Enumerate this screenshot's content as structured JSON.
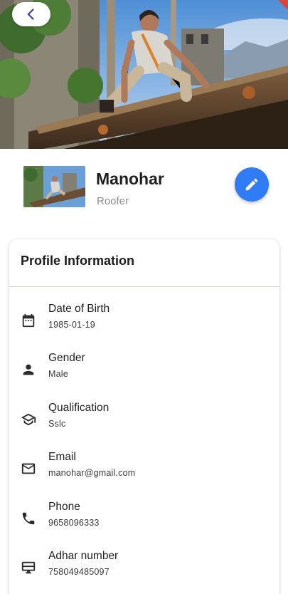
{
  "header": {
    "back_icon": "chevron-left-icon",
    "edit_icon": "pencil-icon",
    "accent": "#2f7cf6"
  },
  "profile": {
    "name": "Manohar",
    "role": "Roofer"
  },
  "card": {
    "title": "Profile Information",
    "items": [
      {
        "icon": "calendar-icon",
        "label": "Date of Birth",
        "value": "1985-01-19"
      },
      {
        "icon": "person-icon",
        "label": "Gender",
        "value": "Male"
      },
      {
        "icon": "graduation-cap-icon",
        "label": "Qualification",
        "value": "Sslc"
      },
      {
        "icon": "mail-icon",
        "label": "Email",
        "value": "manohar@gmail.com"
      },
      {
        "icon": "phone-icon",
        "label": "Phone",
        "value": "9658096333"
      },
      {
        "icon": "id-card-icon",
        "label": "Adhar number",
        "value": "758049485097"
      }
    ]
  }
}
